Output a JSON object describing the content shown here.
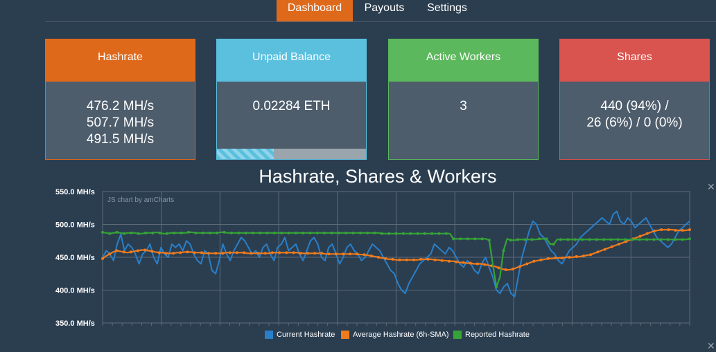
{
  "nav": {
    "tabs": [
      {
        "label": "Dashboard",
        "active": true
      },
      {
        "label": "Payouts",
        "active": false
      },
      {
        "label": "Settings",
        "active": false
      }
    ]
  },
  "cards": {
    "hashrate": {
      "title": "Hashrate",
      "lines": [
        "476.2 MH/s",
        "507.7 MH/s",
        "491.5 MH/s"
      ]
    },
    "balance": {
      "title": "Unpaid Balance",
      "value": "0.02284 ETH",
      "progress_fraction": 0.38
    },
    "workers": {
      "title": "Active Workers",
      "value": "3"
    },
    "shares": {
      "title": "Shares",
      "lines": [
        "440 (94%) /",
        "26 (6%) / 0 (0%)"
      ]
    }
  },
  "colors": {
    "accent": "#df691a",
    "info": "#5bc0de",
    "success": "#5cb85c",
    "danger": "#d9534f",
    "background": "#2b3e50",
    "panel": "#4e5d6c"
  },
  "icons": {
    "close": "close-icon"
  },
  "chart_data": {
    "type": "line",
    "title": "Hashrate, Shares & Workers",
    "credit": "JS chart by amCharts",
    "ylim": [
      350,
      550
    ],
    "yticks": [
      "550.0 MH/s",
      "500.0 MH/s",
      "450.0 MH/s",
      "400.0 MH/s",
      "350.0 MH/s"
    ],
    "ytick_values": [
      550,
      500,
      450,
      400,
      350
    ],
    "grid": true,
    "legend_position": "bottom",
    "series": [
      {
        "name": "Current Hashrate",
        "color": "#2a7fc9",
        "values": [
          450,
          460,
          455,
          445,
          470,
          485,
          460,
          470,
          465,
          455,
          440,
          455,
          460,
          470,
          450,
          440,
          465,
          455,
          450,
          470,
          465,
          470,
          460,
          475,
          470,
          455,
          445,
          440,
          460,
          455,
          430,
          425,
          445,
          470,
          455,
          445,
          460,
          470,
          480,
          475,
          465,
          455,
          460,
          450,
          465,
          470,
          455,
          445,
          465,
          470,
          480,
          460,
          465,
          470,
          455,
          445,
          460,
          475,
          480,
          470,
          450,
          445,
          465,
          470,
          455,
          440,
          450,
          465,
          470,
          460,
          455,
          445,
          450,
          460,
          470,
          465,
          460,
          450,
          440,
          430,
          425,
          410,
          400,
          395,
          410,
          420,
          430,
          440,
          445,
          450,
          455,
          470,
          465,
          460,
          455,
          465,
          460,
          450,
          440,
          435,
          445,
          440,
          430,
          425,
          440,
          450,
          435,
          420,
          400,
          395,
          405,
          410,
          395,
          390,
          420,
          450,
          470,
          490,
          505,
          500,
          485,
          480,
          470,
          460,
          455,
          445,
          440,
          450,
          460,
          465,
          470,
          480,
          485,
          490,
          495,
          500,
          505,
          510,
          505,
          500,
          515,
          520,
          505,
          500,
          510,
          505,
          495,
          500,
          505,
          510,
          500,
          490,
          480,
          475,
          470,
          465,
          470,
          480,
          490,
          495,
          500,
          505
        ]
      },
      {
        "name": "Average Hashrate (6h-SMA)",
        "color": "#f07b1c",
        "values": [
          448,
          452,
          455,
          458,
          460,
          459,
          458,
          457,
          458,
          459,
          460,
          461,
          461,
          460,
          459,
          458,
          457,
          457,
          456,
          456,
          456,
          457,
          457,
          458,
          458,
          458,
          457,
          457,
          457,
          456,
          456,
          456,
          456,
          456,
          456,
          457,
          457,
          457,
          457,
          457,
          457,
          456,
          456,
          456,
          456,
          456,
          456,
          456,
          457,
          457,
          457,
          457,
          457,
          457,
          457,
          457,
          456,
          456,
          456,
          456,
          456,
          456,
          456,
          455,
          455,
          455,
          455,
          455,
          455,
          455,
          455,
          455,
          455,
          454,
          454,
          453,
          452,
          451,
          450,
          449,
          448,
          447,
          447,
          446,
          446,
          446,
          446,
          446,
          446,
          446,
          447,
          447,
          447,
          447,
          446,
          446,
          445,
          445,
          444,
          444,
          443,
          442,
          442,
          441,
          441,
          440,
          440,
          440,
          439,
          438,
          437,
          436,
          434,
          432,
          431,
          431,
          432,
          434,
          436,
          438,
          440,
          442,
          444,
          445,
          446,
          447,
          448,
          448,
          449,
          449,
          449,
          450,
          450,
          450,
          451,
          451,
          452,
          453,
          454,
          456,
          458,
          460,
          462,
          464,
          466,
          468,
          470,
          472,
          474,
          476,
          478,
          480,
          482,
          484,
          486,
          488,
          490,
          491,
          492,
          492,
          492,
          492,
          491,
          491,
          491,
          491,
          492
        ]
      },
      {
        "name": "Reported Hashrate",
        "color": "#36a336",
        "values": [
          488,
          487,
          486,
          487,
          488,
          487,
          486,
          487,
          487,
          487,
          486,
          486,
          487,
          487,
          487,
          488,
          487,
          486,
          486,
          487,
          487,
          487,
          487,
          487,
          488,
          488,
          487,
          487,
          487,
          487,
          487,
          487,
          487,
          488,
          488,
          487,
          487,
          487,
          487,
          487,
          487,
          487,
          487,
          487,
          487,
          487,
          487,
          487,
          487,
          487,
          487,
          487,
          487,
          487,
          487,
          487,
          487,
          487,
          487,
          487,
          487,
          487,
          487,
          487,
          487,
          487,
          487,
          487,
          487,
          487,
          487,
          487,
          487,
          487,
          487,
          487,
          487,
          487,
          486,
          486,
          486,
          486,
          486,
          486,
          486,
          486,
          486,
          486,
          486,
          486,
          486,
          486,
          486,
          486,
          486,
          486,
          486,
          486,
          478,
          478,
          478,
          478,
          478,
          478,
          478,
          478,
          478,
          478,
          476,
          440,
          405,
          420,
          460,
          478,
          476,
          476,
          477,
          477,
          477,
          477,
          477,
          477,
          478,
          478,
          478,
          470,
          470,
          477,
          477,
          477,
          477,
          477,
          477,
          477,
          477,
          477,
          477,
          477,
          477,
          477,
          477,
          477,
          477,
          477,
          477,
          477,
          477,
          477,
          477,
          477,
          477,
          477,
          477,
          477,
          477,
          477,
          477,
          477,
          477,
          477,
          477,
          477,
          477,
          477,
          478
        ]
      }
    ]
  }
}
